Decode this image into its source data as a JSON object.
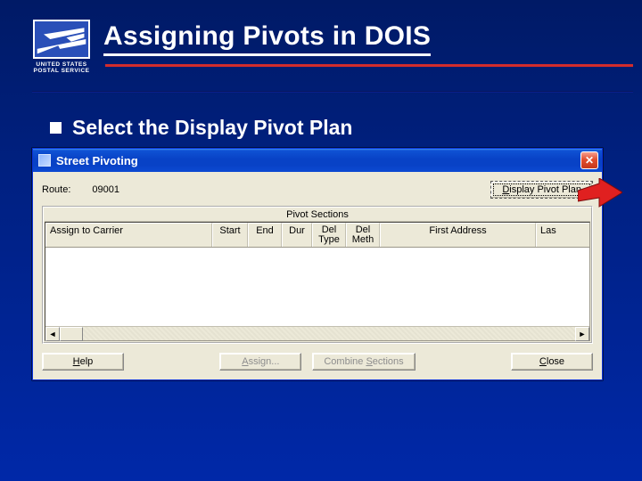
{
  "slide": {
    "title": "Assigning Pivots in DOIS",
    "logo_text": "UNITED STATES\nPOSTAL SERVICE",
    "bullet": "Select the Display Pivot Plan"
  },
  "window": {
    "title": "Street Pivoting",
    "close_glyph": "✕",
    "route_label": "Route:",
    "route_value": "09001",
    "display_btn_prefix": "D",
    "display_btn_rest": "isplay Pivot Plan",
    "section_title": "Pivot Sections",
    "columns": {
      "assign": "Assign to Carrier",
      "start": "Start",
      "end": "End",
      "dur": "Dur",
      "del_type": "Del\nType",
      "del_meth": "Del\nMeth",
      "first_addr": "First Address",
      "last": "Las"
    },
    "scroll": {
      "left": "◄",
      "right": "►"
    },
    "buttons": {
      "help": "elp",
      "help_u": "H",
      "assign": "ssign...",
      "assign_u": "A",
      "combine": "Combine ",
      "combine_u": "S",
      "combine2": "ections",
      "close": "lose",
      "close_u": "C"
    }
  }
}
